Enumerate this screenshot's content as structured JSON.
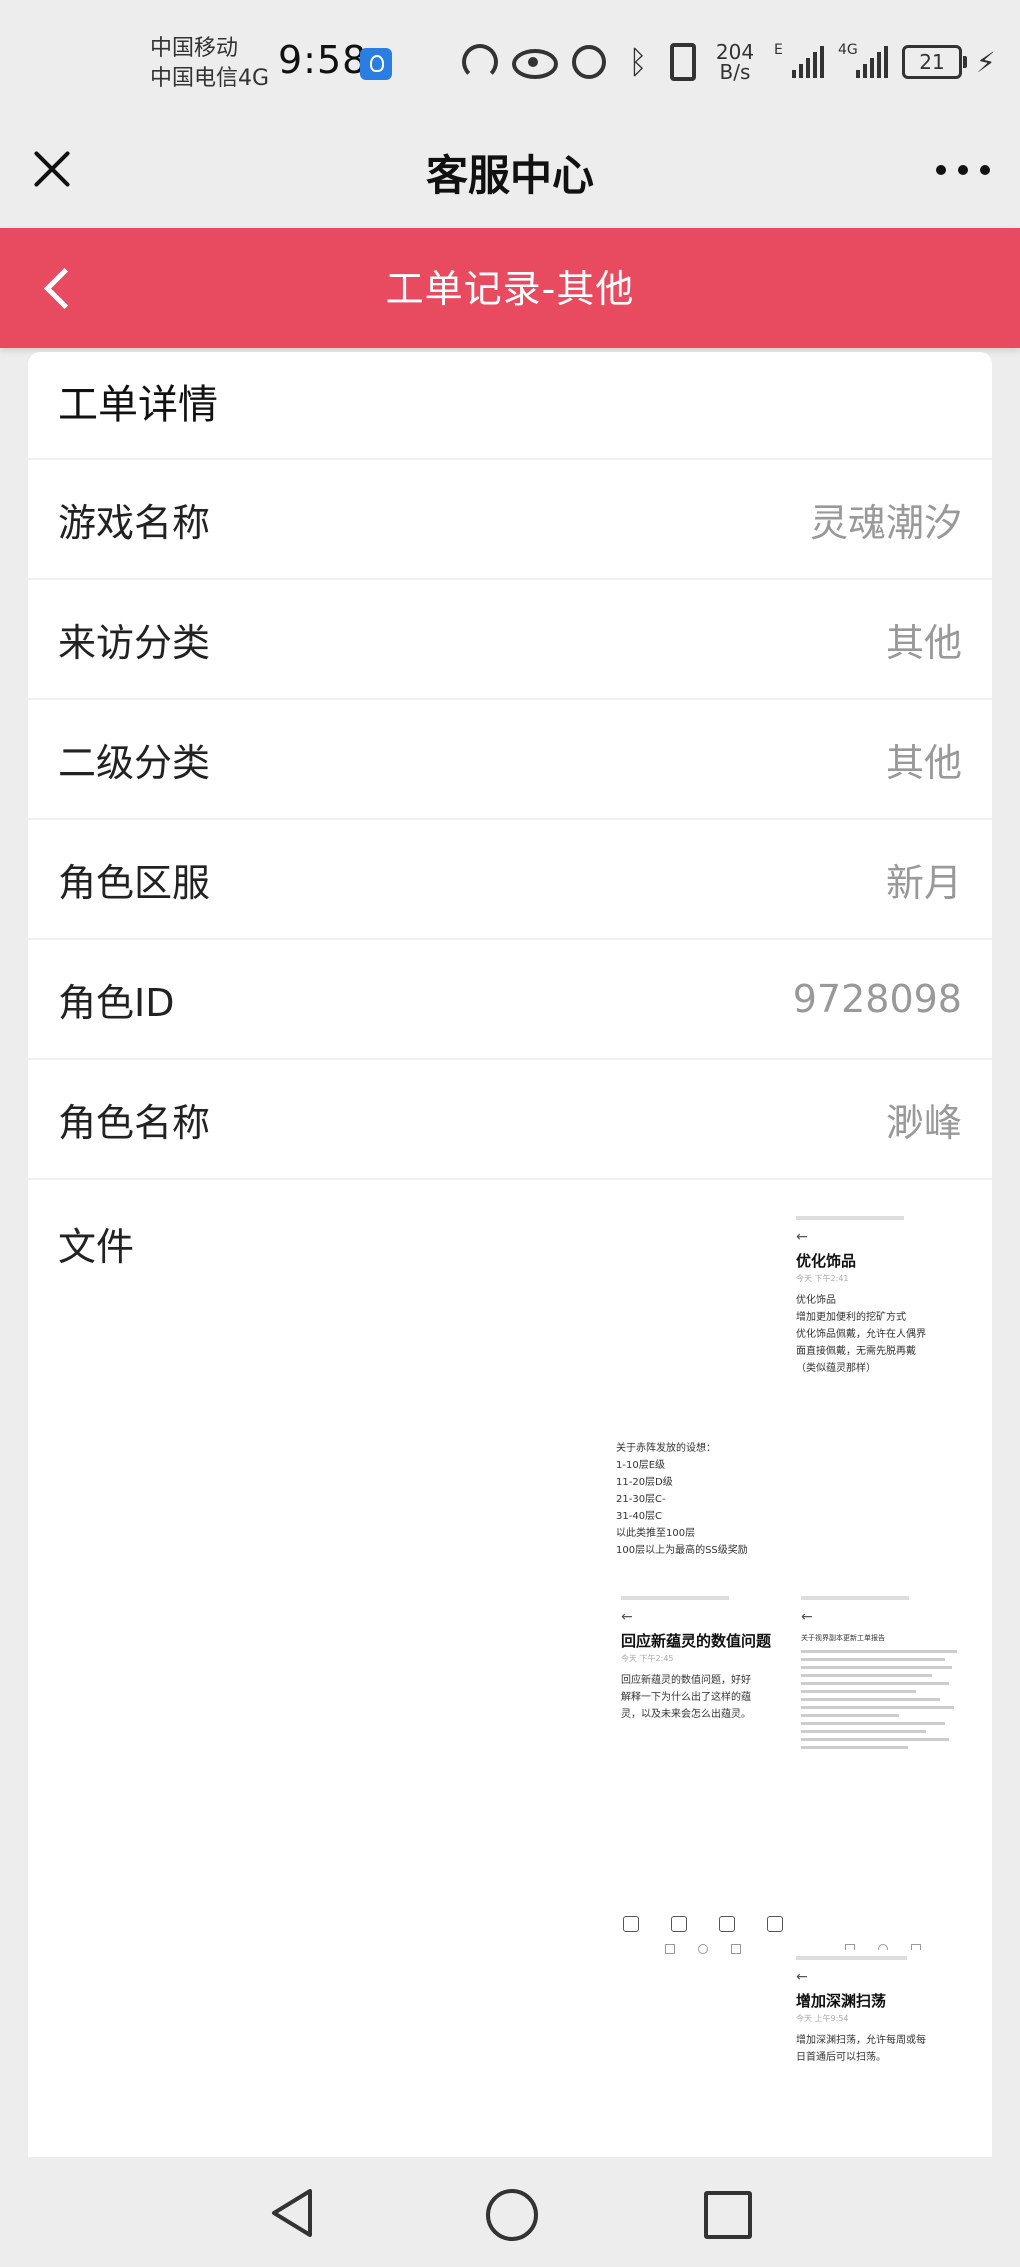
{
  "status_bar": {
    "carrier_line1": "中国移动",
    "carrier_line2": "中国电信4G",
    "time": "9:58",
    "net_speed_value": "204",
    "net_speed_unit": "B/s",
    "signal1_tag": "E",
    "signal2_tag": "4G",
    "battery": "21"
  },
  "title_bar": {
    "title": "客服中心"
  },
  "header": {
    "title": "工单记录-其他"
  },
  "detail": {
    "section_title": "工单详情",
    "rows": [
      {
        "label": "游戏名称",
        "value": "灵魂潮汐"
      },
      {
        "label": "来访分类",
        "value": "其他"
      },
      {
        "label": "二级分类",
        "value": "其他"
      },
      {
        "label": "角色区服",
        "value": "新月"
      },
      {
        "label": "角色ID",
        "value": "9728098"
      },
      {
        "label": "角色名称",
        "value": "渺峰"
      }
    ],
    "file_label": "文件"
  },
  "thumbnails": [
    {
      "title": "优化饰品",
      "meta": "今天 下午2:41",
      "body": "优化饰品\n增加更加便利的挖矿方式\n优化饰品佩戴，允许在人偶界\n面直接佩戴，无需先脱再戴\n（类似蕴灵那样）"
    },
    {
      "title": "",
      "meta": "",
      "body": "关于赤阵发放的设想：\n1-10层E级\n11-20层D级\n21-30层C-\n31-40层C\n以此类推至100层\n100层以上为最高的SS级奖励"
    },
    {
      "title": "回应新蕴灵的数值问题",
      "meta": "今天 下午2:45",
      "body": "回应新蕴灵的数值问题，好好\n解释一下为什么出了这样的蕴\n灵，以及未来会怎么出蕴灵。"
    },
    {
      "title": "",
      "meta": "",
      "body": "关于视界副本更新工单报告"
    },
    {
      "title": "增加深渊扫荡",
      "meta": "今天 上午9:54",
      "body": "增加深渊扫荡，允许每周或每\n日首通后可以扫荡。"
    }
  ],
  "colors": {
    "accent": "#e84a5f",
    "background": "#ededed",
    "card": "#ffffff",
    "label": "#222222",
    "value": "#999999"
  }
}
